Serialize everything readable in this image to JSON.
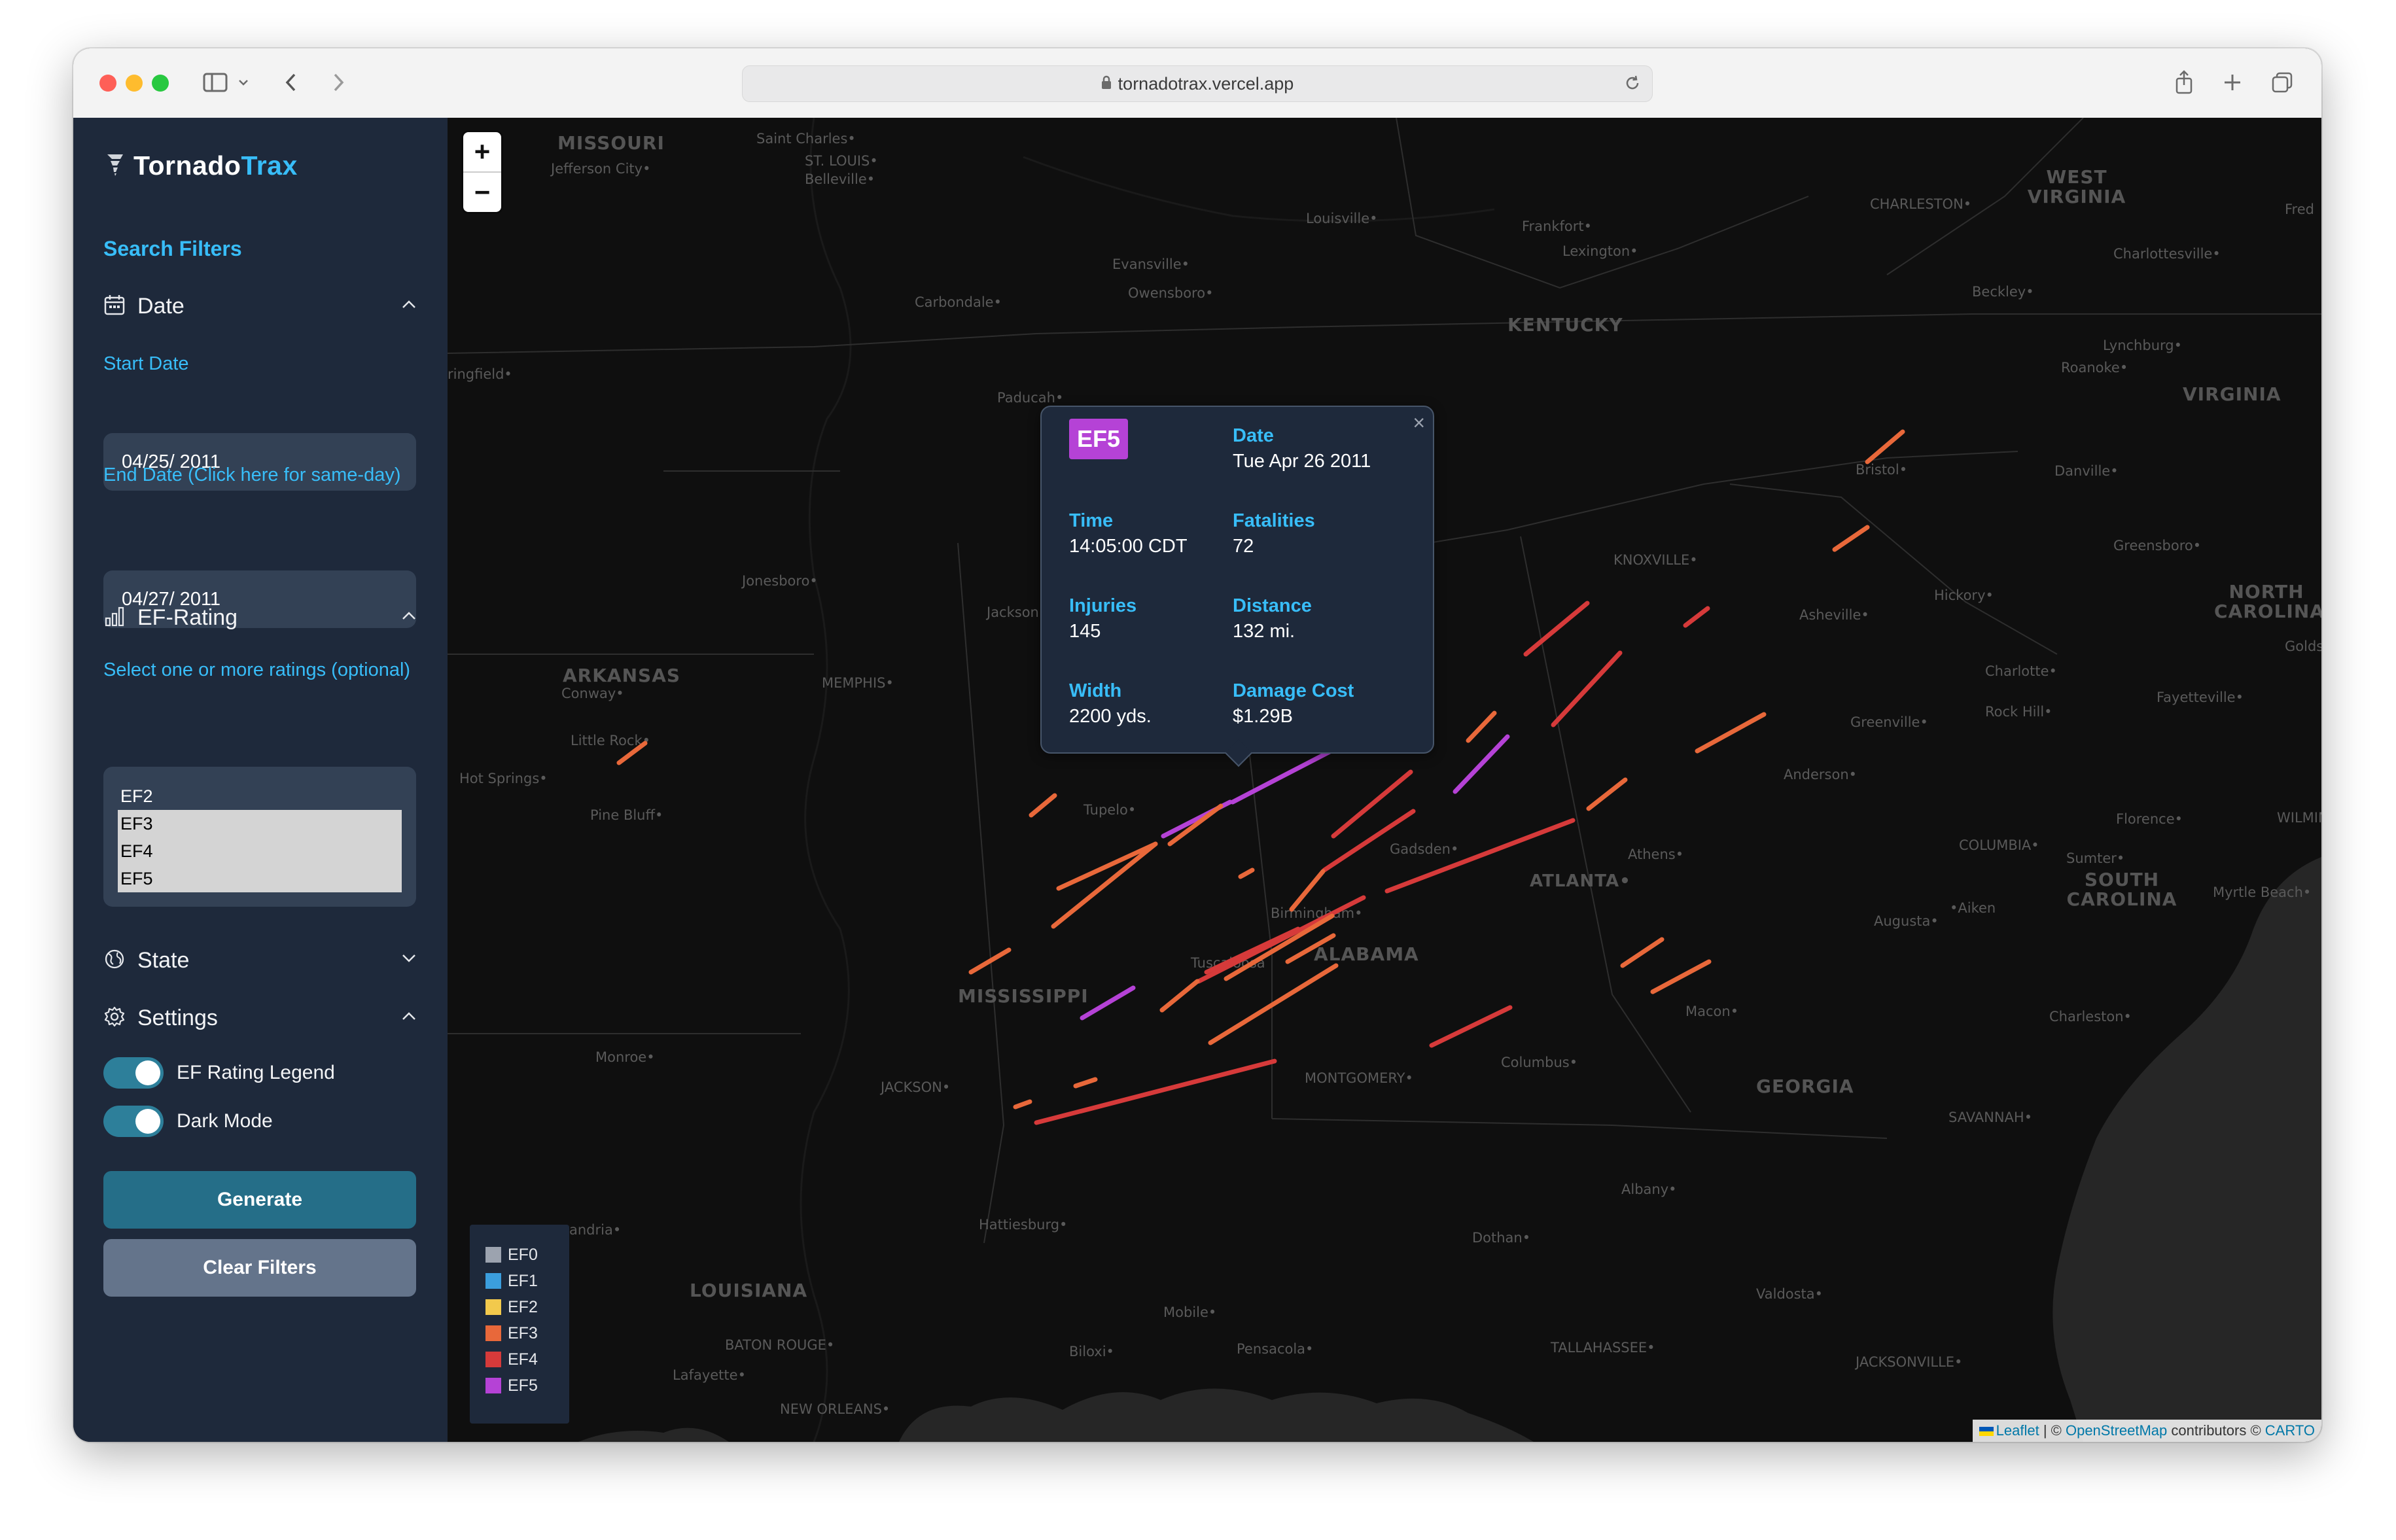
{
  "browser": {
    "url": "tornadotrax.vercel.app"
  },
  "app": {
    "logo_part1": "Tornado",
    "logo_part2": "Trax"
  },
  "sidebar": {
    "search_filters_title": "Search Filters",
    "date_section": {
      "label": "Date",
      "start_label": "Start Date",
      "start_value": "04/25/ 2011",
      "end_label": "End Date (Click here for same-day)",
      "end_value": "04/27/ 2011"
    },
    "ef_section": {
      "label": "EF-Rating",
      "hint": "Select one or more ratings (optional)",
      "options": [
        {
          "label": "EF2",
          "selected": false
        },
        {
          "label": "EF3",
          "selected": true
        },
        {
          "label": "EF4",
          "selected": true
        },
        {
          "label": "EF5",
          "selected": true
        }
      ]
    },
    "state_section": {
      "label": "State"
    },
    "settings_section": {
      "label": "Settings",
      "toggle_legend": "EF Rating Legend",
      "toggle_dark": "Dark Mode"
    },
    "generate_button": "Generate",
    "clear_button": "Clear Filters"
  },
  "map": {
    "zoom_in": "+",
    "zoom_out": "−",
    "labels": {
      "missouri": "MISSOURI",
      "jefferson_city": "Jefferson City•",
      "saint_charles": "Saint Charles•",
      "st_louis": "ST. LOUIS•",
      "belleville": "Belleville•",
      "springfield": "ringfield•",
      "carbondale": "Carbondale•",
      "evansville": "Evansville•",
      "owensboro": "Owensboro•",
      "louisville": "Louisville•",
      "frankfort": "Frankfort•",
      "lexington": "Lexington•",
      "kentucky": "KENTUCKY",
      "charleston_wv": "CHARLESTON•",
      "west_virginia": "WEST VIRGINIA",
      "charlottesville": "Charlottesville•",
      "beckley": "Beckley•",
      "lynchburg": "Lynchburg•",
      "roanoke": "Roanoke•",
      "virginia": "VIRGINIA",
      "danville": "Danville•",
      "bristol": "Bristol•",
      "paducah": "Paducah•",
      "jonesboro": "Jonesboro•",
      "jackson_tn": "Jackson",
      "knoxville": "KNOXVILLE•",
      "asheville": "Asheville•",
      "hickory": "Hickory•",
      "greensboro": "Greensboro•",
      "north_carolina": "NORTH CAROLINA",
      "goldsboro": "Goldsbor",
      "arkansas": "ARKANSAS",
      "conway": "Conway•",
      "memphis": "MEMPHIS•",
      "little_rock": "Little Rock•",
      "hot_springs": "Hot Springs•",
      "pine_bluff": "Pine Bluff•",
      "tupelo": "Tupelo•",
      "charlotte": "Charlotte•",
      "rock_hill": "Rock Hill•",
      "fayetteville": "Fayetteville•",
      "greenville": "Greenville•",
      "anderson": "Anderson•",
      "florence": "Florence•",
      "wilmington": "WILMINGTO",
      "gadsden": "Gadsden•",
      "athens": "Athens•",
      "columbia": "COLUMBIA•",
      "sumter": "Sumter•",
      "south_carolina": "SOUTH CAROLINA",
      "atlanta": "ATLANTA•",
      "birmingham": "Birmingham•",
      "tuscaloosa": "Tuscaloosa",
      "alabama": "ALABAMA",
      "augusta": "Augusta•",
      "aiken": "•Aiken",
      "myrtle_beach": "Myrtle Beach•",
      "mississippi": "MISSISSIPPI",
      "monroe": "Monroe•",
      "jackson_ms": "JACKSON•",
      "montgomery": "MONTGOMERY•",
      "columbus": "Columbus•",
      "macon": "Macon•",
      "georgia": "GEORGIA",
      "charleston_sc": "Charleston•",
      "savannah": "SAVANNAH•",
      "alexandria": "andria•",
      "hattiesburg": "Hattiesburg•",
      "albany": "Albany•",
      "dothan": "Dothan•",
      "valdosta": "Valdosta•",
      "louisiana": "LOUISIANA",
      "baton_rouge": "BATON ROUGE•",
      "lafayette": "Lafayette•",
      "mobile": "Mobile•",
      "biloxi": "Biloxi•",
      "pensacola": "Pensacola•",
      "tallahassee": "TALLAHASSEE•",
      "jacksonville": "JACKSONVILLE•",
      "new_orleans": "NEW ORLEANS•",
      "fred": "Fred"
    },
    "popup": {
      "rating": "EF5",
      "rating_color": "#b542d6",
      "date_label": "Date",
      "date_value": "Tue Apr 26 2011",
      "time_label": "Time",
      "time_value": "14:05:00 CDT",
      "fatalities_label": "Fatalities",
      "fatalities_value": "72",
      "injuries_label": "Injuries",
      "injuries_value": "145",
      "distance_label": "Distance",
      "distance_value": "132 mi.",
      "width_label": "Width",
      "width_value": "2200 yds.",
      "damage_label": "Damage Cost",
      "damage_value": "$1.29B",
      "close": "×"
    },
    "legend": [
      {
        "label": "EF0",
        "color": "#9ca3af"
      },
      {
        "label": "EF1",
        "color": "#3b9edd"
      },
      {
        "label": "EF2",
        "color": "#f2c94c"
      },
      {
        "label": "EF3",
        "color": "#e8683a"
      },
      {
        "label": "EF4",
        "color": "#d63a3a"
      },
      {
        "label": "EF5",
        "color": "#b542d6"
      }
    ],
    "attribution": {
      "leaflet": "Leaflet",
      "sep1": " | © ",
      "osm": "OpenStreetMap",
      "contrib": " contributors © ",
      "carto": "CARTO"
    }
  },
  "colors": {
    "sidebar_bg": "#1e293b",
    "accent": "#38bdf8",
    "generate_bg": "#256e88",
    "clear_bg": "#64748b",
    "ef3": "#e8683a",
    "ef4": "#d63a3a",
    "ef5": "#b542d6"
  }
}
